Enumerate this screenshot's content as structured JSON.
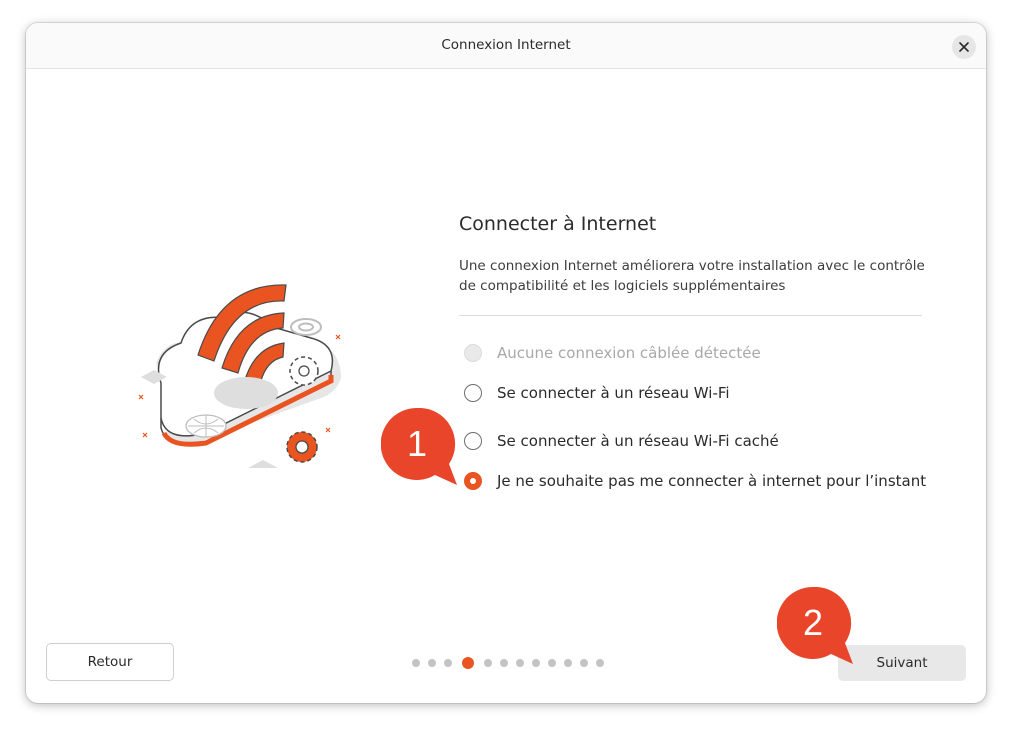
{
  "window": {
    "title": "Connexion Internet"
  },
  "page": {
    "heading": "Connecter à Internet",
    "description": "Une connexion Internet améliorera votre installation avec le contrôle de compatibilité et les logiciels supplémentaires"
  },
  "options": [
    {
      "label": "Aucune connexion câblée détectée",
      "state": "disabled"
    },
    {
      "label": "Se connecter à un réseau Wi-Fi",
      "state": "unchecked"
    },
    {
      "label": "Se connecter à un réseau Wi-Fi caché",
      "state": "unchecked"
    },
    {
      "label": "Je ne souhaite pas me connecter à internet pour l’instant",
      "state": "checked"
    }
  ],
  "buttons": {
    "back": "Retour",
    "next": "Suivant"
  },
  "progress": {
    "total_steps": 12,
    "current_step": 4
  },
  "callouts": {
    "first": "1",
    "second": "2"
  },
  "colors": {
    "accent": "#e95420",
    "callout": "#e8452a"
  },
  "icons": {
    "close": "close-icon",
    "illustration": "wifi-cloud-illustration"
  }
}
